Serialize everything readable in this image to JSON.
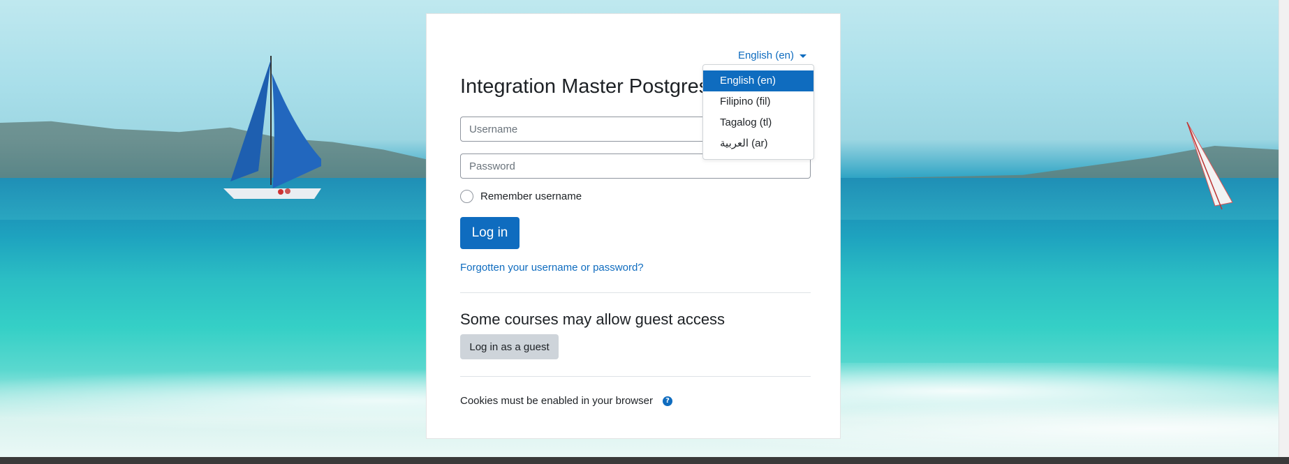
{
  "site_title": "Integration Master Postgres",
  "language": {
    "current": "English (en)",
    "options": [
      "English (en)",
      "Filipino (fil)",
      "Tagalog (tl)",
      "العربية (ar)"
    ],
    "selected_index": 0
  },
  "login": {
    "username_placeholder": "Username",
    "password_placeholder": "Password",
    "remember_label": "Remember username",
    "login_button": "Log in",
    "forgot_link": "Forgotten your username or password?"
  },
  "guest": {
    "heading": "Some courses may allow guest access",
    "button": "Log in as a guest"
  },
  "cookies_notice": "Cookies must be enabled in your browser",
  "colors": {
    "primary": "#0f6cbf",
    "secondary_button": "#ced4da"
  }
}
